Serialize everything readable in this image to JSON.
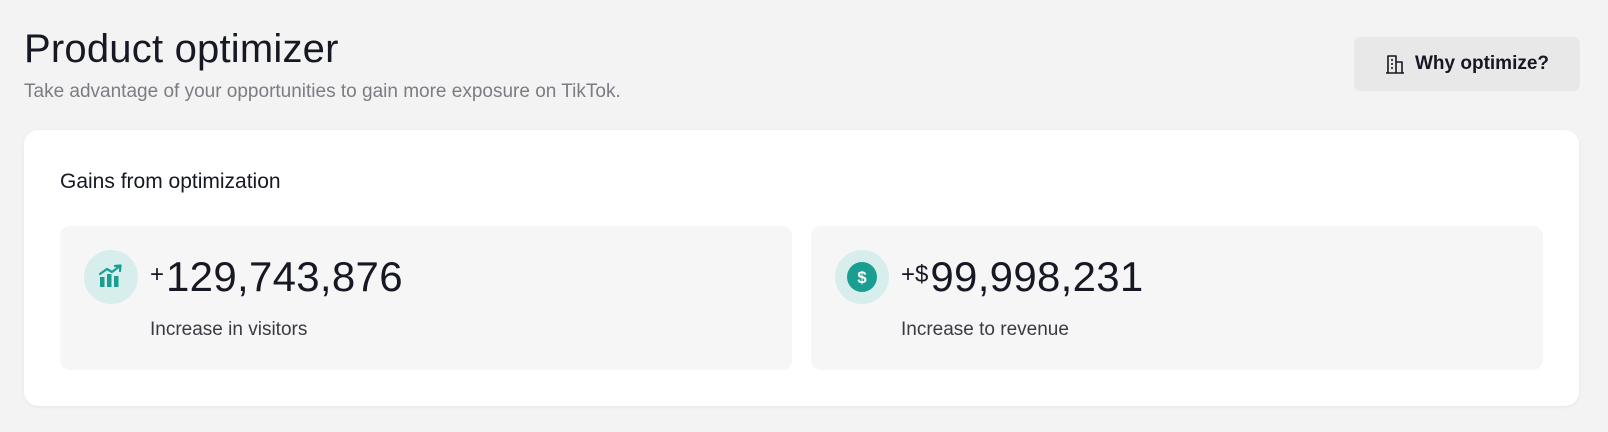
{
  "header": {
    "title": "Product optimizer",
    "subtitle": "Take advantage of your opportunities to gain more exposure on TikTok.",
    "why_button_label": "Why optimize?",
    "why_button_icon": "building-icon"
  },
  "gains": {
    "title": "Gains from optimization",
    "metrics": [
      {
        "icon": "chart-up-icon",
        "prefix": "+",
        "value": "129,743,876",
        "label": "Increase in visitors"
      },
      {
        "icon": "dollar-circle-icon",
        "prefix": "+$",
        "value": "99,998,231",
        "label": "Increase to revenue"
      }
    ]
  },
  "colors": {
    "accent_teal": "#1a9e92",
    "icon_bg": "#d8eeec",
    "page_bg": "#f3f3f3"
  }
}
